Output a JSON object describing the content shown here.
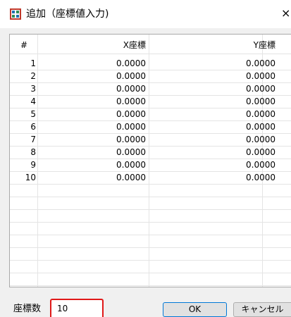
{
  "window": {
    "title": "追加（座標値入力)",
    "icon": "app-icon",
    "close_glyph": "×"
  },
  "table": {
    "headers": [
      "#",
      "X座標",
      "Y座標"
    ],
    "rows": [
      [
        "1",
        "0.0000",
        "0.0000"
      ],
      [
        "2",
        "0.0000",
        "0.0000"
      ],
      [
        "3",
        "0.0000",
        "0.0000"
      ],
      [
        "4",
        "0.0000",
        "0.0000"
      ],
      [
        "5",
        "0.0000",
        "0.0000"
      ],
      [
        "6",
        "0.0000",
        "0.0000"
      ],
      [
        "7",
        "0.0000",
        "0.0000"
      ],
      [
        "8",
        "0.0000",
        "0.0000"
      ],
      [
        "9",
        "0.0000",
        "0.0000"
      ],
      [
        "10",
        "0.0000",
        "0.0000"
      ]
    ]
  },
  "footer": {
    "count_label": "座標数",
    "count_value": "10",
    "ok_label": "OK",
    "cancel_label": "キャンセル"
  },
  "colors": {
    "highlight": "#e01818",
    "default_button_border": "#0078d7",
    "grid_line": "#e4e4e4"
  }
}
